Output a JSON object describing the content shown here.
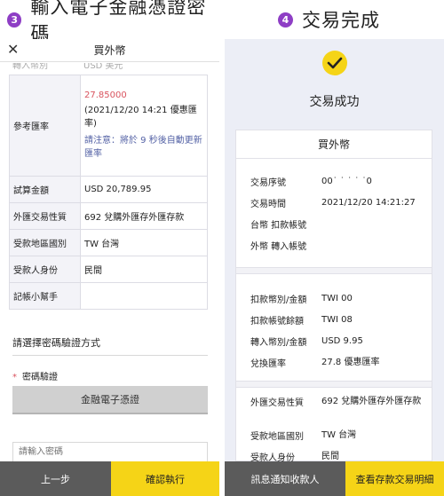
{
  "left_panel": {
    "step_number": "3",
    "step_title": "輸入電子金融憑證密碼",
    "nav_title": "買外幣",
    "close_icon": "close-icon",
    "clipped_row": {
      "key": "轉入幣別",
      "value": "USD 美元"
    },
    "exchange_rate": {
      "key": "參考匯率",
      "rate": "27.85000",
      "timestamp": "(2021/12/20 14:21 優惠匯率)",
      "note": "請注意：將於 9 秒後自動更新匯率"
    },
    "rows": [
      {
        "key": "試算金額",
        "value": "USD 20,789.95"
      },
      {
        "key": "外匯交易性質",
        "value": "692 兌購外匯存外匯存款"
      },
      {
        "key": "受款地區國別",
        "value": "TW 台灣"
      },
      {
        "key": "受款人身份",
        "value": "民間"
      },
      {
        "key": "記帳小幫手",
        "value": ""
      }
    ],
    "verify_heading": "請選擇密碼驗證方式",
    "password_label": "密碼驗證",
    "cert_button": "金融電子憑證",
    "password_placeholder": "請輸入密碼",
    "prev_button": "上一步",
    "confirm_button": "確認執行"
  },
  "right_panel": {
    "step_number": "4",
    "step_title": "交易完成",
    "success_icon": "check-circle-icon",
    "success_title": "交易成功",
    "card_title": "買外幣",
    "section1": [
      {
        "key": "交易序號",
        "value": "00˙ ˙ ˙ ˙ ˙0"
      },
      {
        "key": "交易時間",
        "value": "2021/12/20 14:21:27"
      },
      {
        "key": "台幣 扣款帳號",
        "value": ""
      },
      {
        "key": "外幣 轉入帳號",
        "value": ""
      }
    ],
    "section2": [
      {
        "key": "扣款幣別/金額",
        "value": "TWI        00"
      },
      {
        "key": "扣款帳號餘額",
        "value": "TWI        08"
      },
      {
        "key": "轉入幣別/金額",
        "value": "USD       9.95"
      },
      {
        "key": "兌換匯率",
        "value": "27.8      優惠匯率"
      }
    ],
    "section3": [
      {
        "key": "外匯交易性質",
        "value": "692 兌購外匯存外匯存款"
      },
      {
        "key": "受款地區國別",
        "value": "TW 台灣"
      },
      {
        "key": "受款人身份",
        "value": "民間"
      }
    ],
    "notify_button": "訊息通知收款人",
    "detail_button": "查看存款交易明細"
  },
  "colors": {
    "step_badge": "#8e3ec5",
    "accent_yellow": "#f5d417",
    "rate_red": "#d9535e",
    "note_blue": "#5563a6",
    "button_gray": "#5b5b5b"
  }
}
